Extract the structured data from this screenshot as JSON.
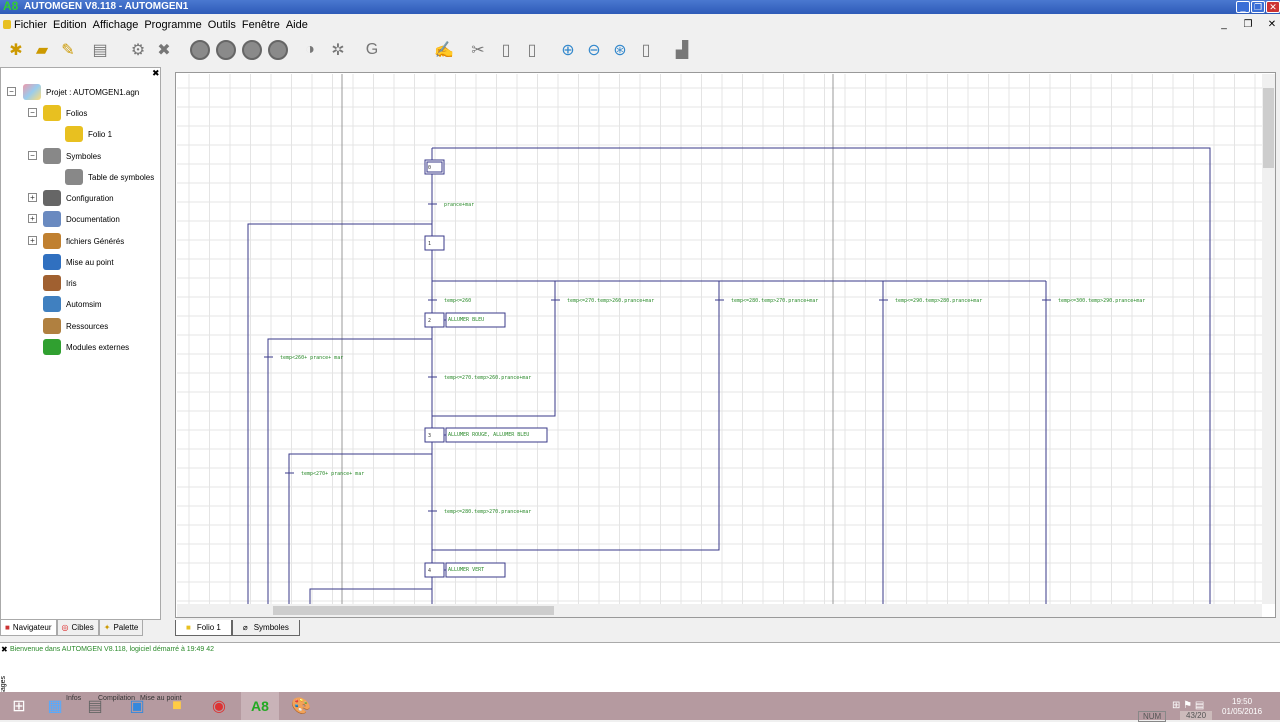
{
  "window": {
    "title": "AUTOMGEN V8.118 - AUTOMGEN1"
  },
  "menu": [
    "Fichier",
    "Edition",
    "Affichage",
    "Programme",
    "Outils",
    "Fenêtre",
    "Aide"
  ],
  "toolbar": [
    "new-icon",
    "open-icon",
    "save-icon",
    "print-icon",
    "compile-icon",
    "stop-compile-icon",
    "run-icon",
    "pause-icon",
    "stop-icon",
    "step-icon",
    "target-icon",
    "settings-icon",
    "grafcet-icon",
    "blank-icon",
    "edit-icon",
    "cut-icon",
    "copy-icon",
    "paste-icon",
    "zoom-in-icon",
    "zoom-out-icon",
    "zoom-fit-icon",
    "page-icon",
    "tool-icon"
  ],
  "tree": {
    "root": "Projet : AUTOMGEN1.agn",
    "items": [
      {
        "label": "Folios",
        "color": "#e8c020"
      },
      {
        "label": "Folio 1",
        "color": "#e8c020"
      },
      {
        "label": "Symboles",
        "color": "#888888"
      },
      {
        "label": "Table de symboles",
        "color": "#888888"
      },
      {
        "label": "Configuration",
        "color": "#666666"
      },
      {
        "label": "Documentation",
        "color": "#6a8ac0"
      },
      {
        "label": "fichiers Générés",
        "color": "#c08030"
      },
      {
        "label": "Mise au point",
        "color": "#3070c0"
      },
      {
        "label": "Iris",
        "color": "#a06030"
      },
      {
        "label": "Automsim",
        "color": "#4080c0"
      },
      {
        "label": "Ressources",
        "color": "#b08040"
      },
      {
        "label": "Modules externes",
        "color": "#30a030"
      }
    ]
  },
  "left_tabs": [
    "Navigateur",
    "Cibles",
    "Palette"
  ],
  "folio_tabs": [
    "Folio 1",
    "Symboles"
  ],
  "diagram": {
    "steps": [
      {
        "num": "0",
        "action": ""
      },
      {
        "num": "1",
        "action": ""
      },
      {
        "num": "2",
        "action": "ALLUMER BLEU"
      },
      {
        "num": "3",
        "action": "ALLUMER ROUGE, ALLUMER BLEU"
      },
      {
        "num": "4",
        "action": "ALLUMER VERT"
      }
    ],
    "transitions": [
      "prance+mar",
      "temp<=260",
      "temp<=270.temp>260.prance+mar",
      "temp<=280.temp>270.prance+mar",
      "temp<=290.temp>280.prance+mar",
      "temp<=300.temp>290.prance+mar",
      "temp<260+ prance+ mar",
      "temp<=270.temp>260.prance+mar",
      "temp<270+ prance+ mar",
      "temp<=280.temp>270.prance+mar"
    ],
    "line_color": "#3a3a8a",
    "text_color": "#2a8a2a"
  },
  "messages": {
    "text": "Bienvenue dans AUTOMGEN V8.118, logiciel démarré à 19:49 42",
    "side_label": "Messages",
    "tabs": [
      "Infos",
      "Compilation",
      "Mise au point"
    ]
  },
  "taskbar": {
    "time": "19:50",
    "date": "01/05/2016",
    "num": "NUM",
    "pos": "43/20"
  }
}
